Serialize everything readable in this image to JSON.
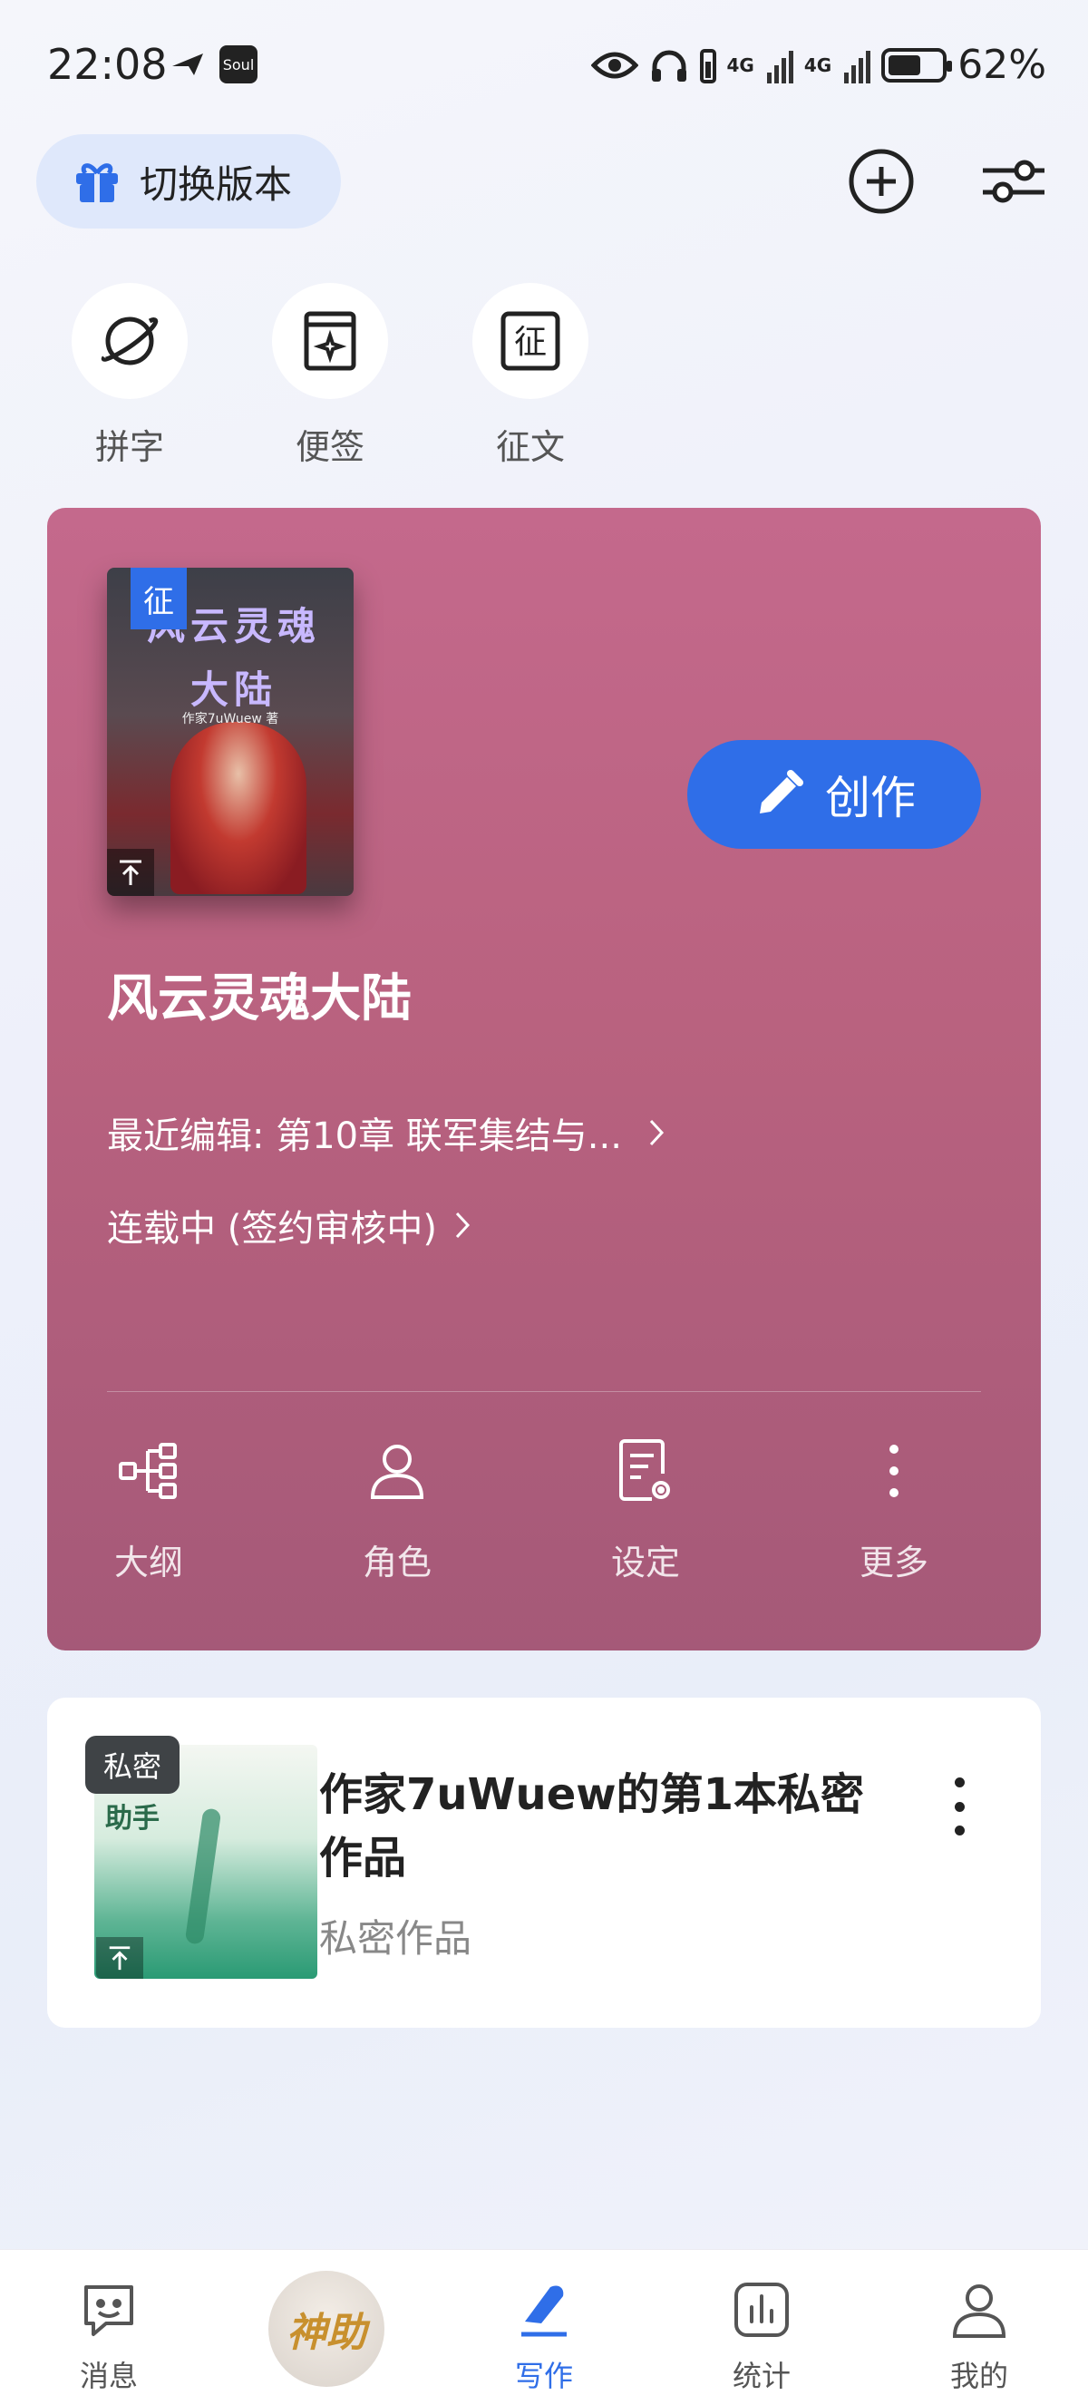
{
  "status_bar": {
    "time": "22:08",
    "soul_label": "Soul",
    "network_1": "4G",
    "network_2": "4G",
    "battery_percent": "62%",
    "battery_level": 0.62
  },
  "header": {
    "switch_version_label": "切换版本"
  },
  "quick_actions": [
    {
      "label": "拼字",
      "icon": "planet-icon"
    },
    {
      "label": "便签",
      "icon": "note-icon"
    },
    {
      "label": "征文",
      "icon": "contest-icon"
    }
  ],
  "book": {
    "cover_tag": "征",
    "cover_title": "风云灵魂大陆",
    "cover_author": "作家7uWuew 著",
    "create_label": "创作",
    "title": "风云灵魂大陆",
    "recent_edit": "最近编辑: 第10章 联军集结与...",
    "serial_status": "连载中 (签约审核中)",
    "tools": [
      {
        "label": "大纲",
        "icon": "outline-icon"
      },
      {
        "label": "角色",
        "icon": "character-icon"
      },
      {
        "label": "设定",
        "icon": "setting-doc-icon"
      },
      {
        "label": "更多",
        "icon": "more-icon"
      }
    ]
  },
  "private_book": {
    "tag": "私密",
    "cover_text": "助手",
    "title": "作家7uWuew的第1本私密作品",
    "subtitle": "私密作品"
  },
  "bottom_nav": {
    "items": [
      {
        "label": "消息",
        "icon": "message-icon"
      },
      {
        "label": "写作",
        "icon": "pen-icon"
      },
      {
        "label": "统计",
        "icon": "stats-icon"
      },
      {
        "label": "我的",
        "icon": "profile-icon"
      }
    ],
    "shenzhu_label": "神助",
    "active": "写作"
  },
  "colors": {
    "accent": "#2f6ee8",
    "card": "#b9627f"
  }
}
